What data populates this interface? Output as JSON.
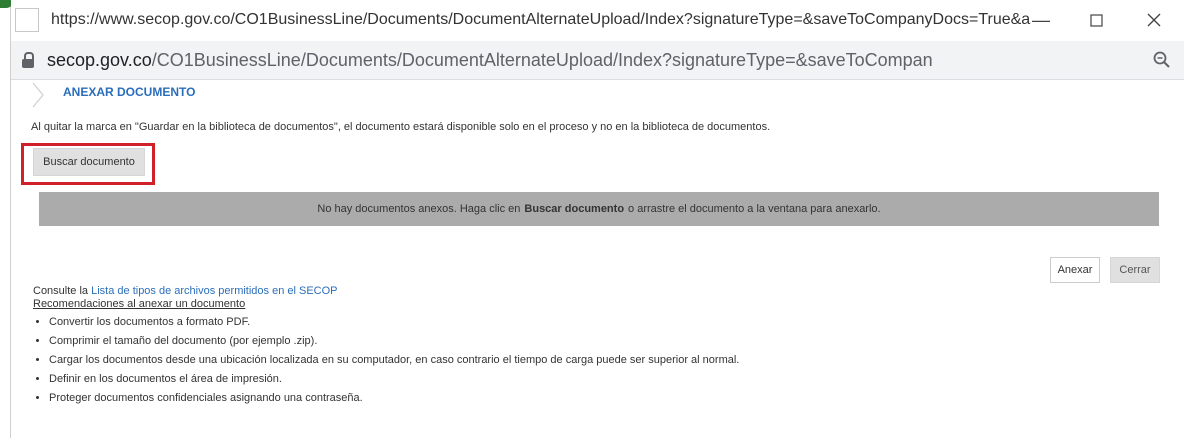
{
  "browser": {
    "title_url": "https://www.secop.gov.co/CO1BusinessLine/Documents/DocumentAlternateUpload/Index?signatureType=&saveToCompanyDocs=True&asPopupVie...",
    "address_domain": "secop.gov.co",
    "address_path": "/CO1BusinessLine/Documents/DocumentAlternateUpload/Index?signatureType=&saveToCompanyDocs=True&asPopupView=true...",
    "icons": {
      "lock": "lock-icon",
      "zoom": "zoom-icon",
      "minimize": "minimize-icon",
      "maximize": "maximize-icon",
      "close": "close-icon"
    }
  },
  "page": {
    "heading": "ANEXAR DOCUMENTO",
    "notice": "Al quitar la marca en \"Guardar en la biblioteca de documentos\", el documento estará disponible solo en el proceso y no en la biblioteca de documentos.",
    "search_button": "Buscar documento",
    "dropzone": {
      "prefix": "No hay documentos anexos. Haga clic en",
      "bold": "Buscar documento",
      "suffix": "o arrastre el documento a la ventana para anexarlo."
    },
    "anexar_button": "Anexar",
    "cerrar_button": "Cerrar",
    "consult_prefix": "Consulte la",
    "consult_link": "Lista de tipos de archivos permitidos en el SECOP",
    "recommendations_title": "Recomendaciones al anexar un documento",
    "recommendations": [
      "Convertir los documentos a formato PDF.",
      "Comprimir el tamaño del documento (por ejemplo .zip).",
      "Cargar los documentos desde una ubicación localizada en su computador, en caso contrario el tiempo de carga puede ser superior al normal.",
      "Definir en los documentos el área de impresión.",
      "Proteger documentos confidenciales asignando una contraseña."
    ]
  },
  "colors": {
    "heading": "#2a6ebb",
    "highlight": "#d0202a",
    "dropzone": "#ababab"
  }
}
